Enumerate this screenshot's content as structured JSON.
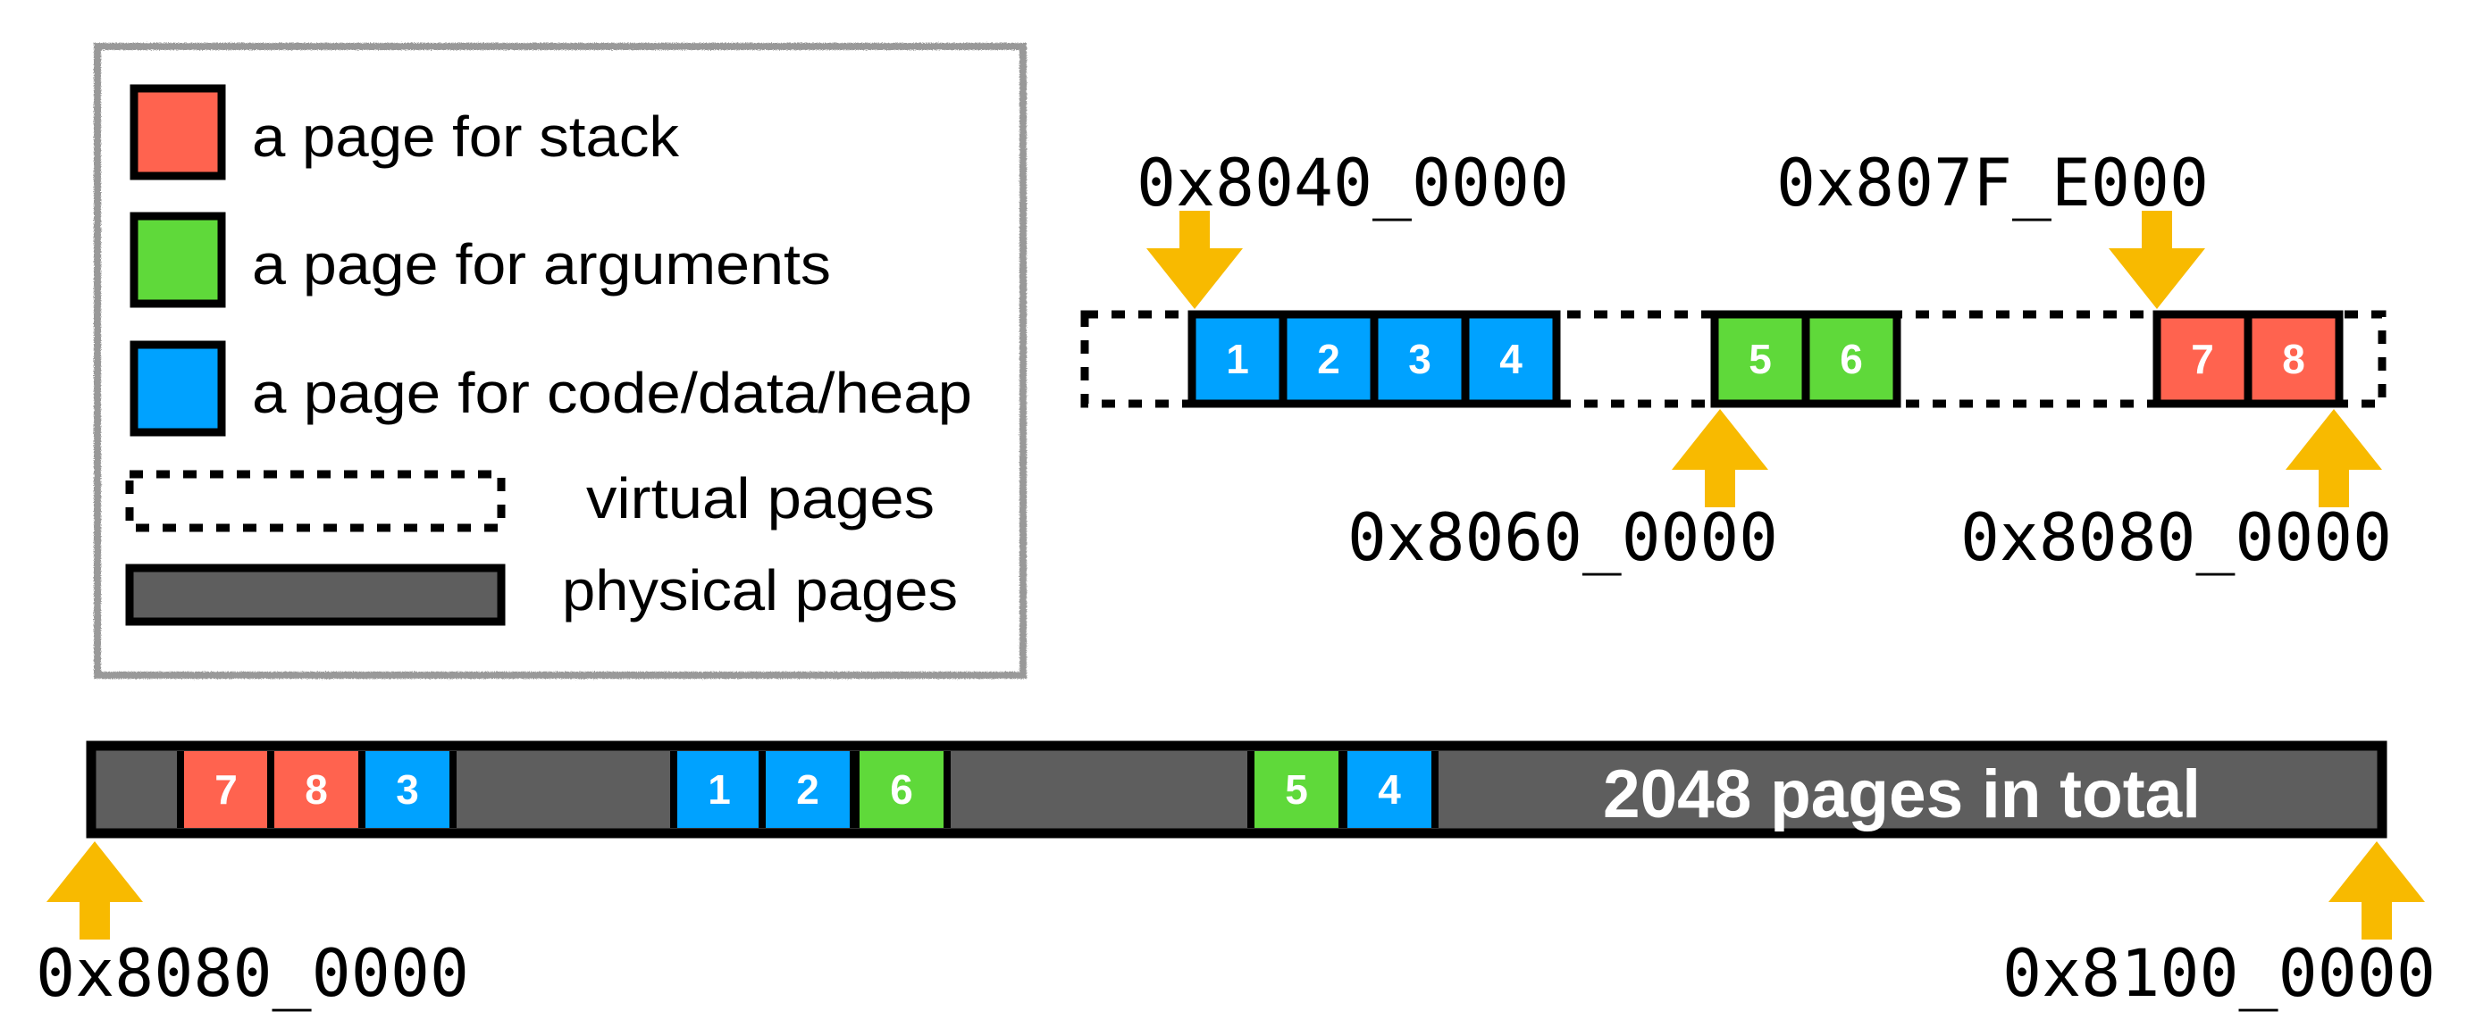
{
  "colors": {
    "stack": "#FF634F",
    "arguments": "#5FD93A",
    "code": "#00A2FF",
    "physical": "#5E5E5E",
    "arrow": "#F8BA00",
    "legend_border": "#999999"
  },
  "legend": {
    "items": [
      {
        "kind": "stack",
        "label": "a page for stack"
      },
      {
        "kind": "arguments",
        "label": "a page for arguments"
      },
      {
        "kind": "code",
        "label": "a page for code/data/heap"
      },
      {
        "kind": "virtual",
        "label": "virtual pages"
      },
      {
        "kind": "physical",
        "label": "physical pages"
      }
    ]
  },
  "virtual": {
    "groups": [
      {
        "kind": "code",
        "pages": [
          "1",
          "2",
          "3",
          "4"
        ]
      },
      {
        "kind": "arguments",
        "pages": [
          "5",
          "6"
        ]
      },
      {
        "kind": "stack",
        "pages": [
          "7",
          "8"
        ]
      }
    ],
    "addresses": [
      {
        "label": "0x8040_0000",
        "points_to": "start of page 1",
        "direction": "down"
      },
      {
        "label": "0x8060_0000",
        "points_to": "start of page 5",
        "direction": "up"
      },
      {
        "label": "0x807F_E000",
        "points_to": "start of page 7",
        "direction": "down"
      },
      {
        "label": "0x8080_0000",
        "points_to": "end of page 8",
        "direction": "up"
      }
    ]
  },
  "physical": {
    "total_label": "2048 pages in total",
    "segments": [
      {
        "kind": "free"
      },
      {
        "kind": "stack",
        "page": "7"
      },
      {
        "kind": "stack",
        "page": "8"
      },
      {
        "kind": "code",
        "page": "3"
      },
      {
        "kind": "free"
      },
      {
        "kind": "code",
        "page": "1"
      },
      {
        "kind": "code",
        "page": "2"
      },
      {
        "kind": "arguments",
        "page": "6"
      },
      {
        "kind": "free"
      },
      {
        "kind": "arguments",
        "page": "5"
      },
      {
        "kind": "code",
        "page": "4"
      },
      {
        "kind": "free"
      }
    ],
    "start_address": "0x8080_0000",
    "end_address": "0x8100_0000"
  }
}
